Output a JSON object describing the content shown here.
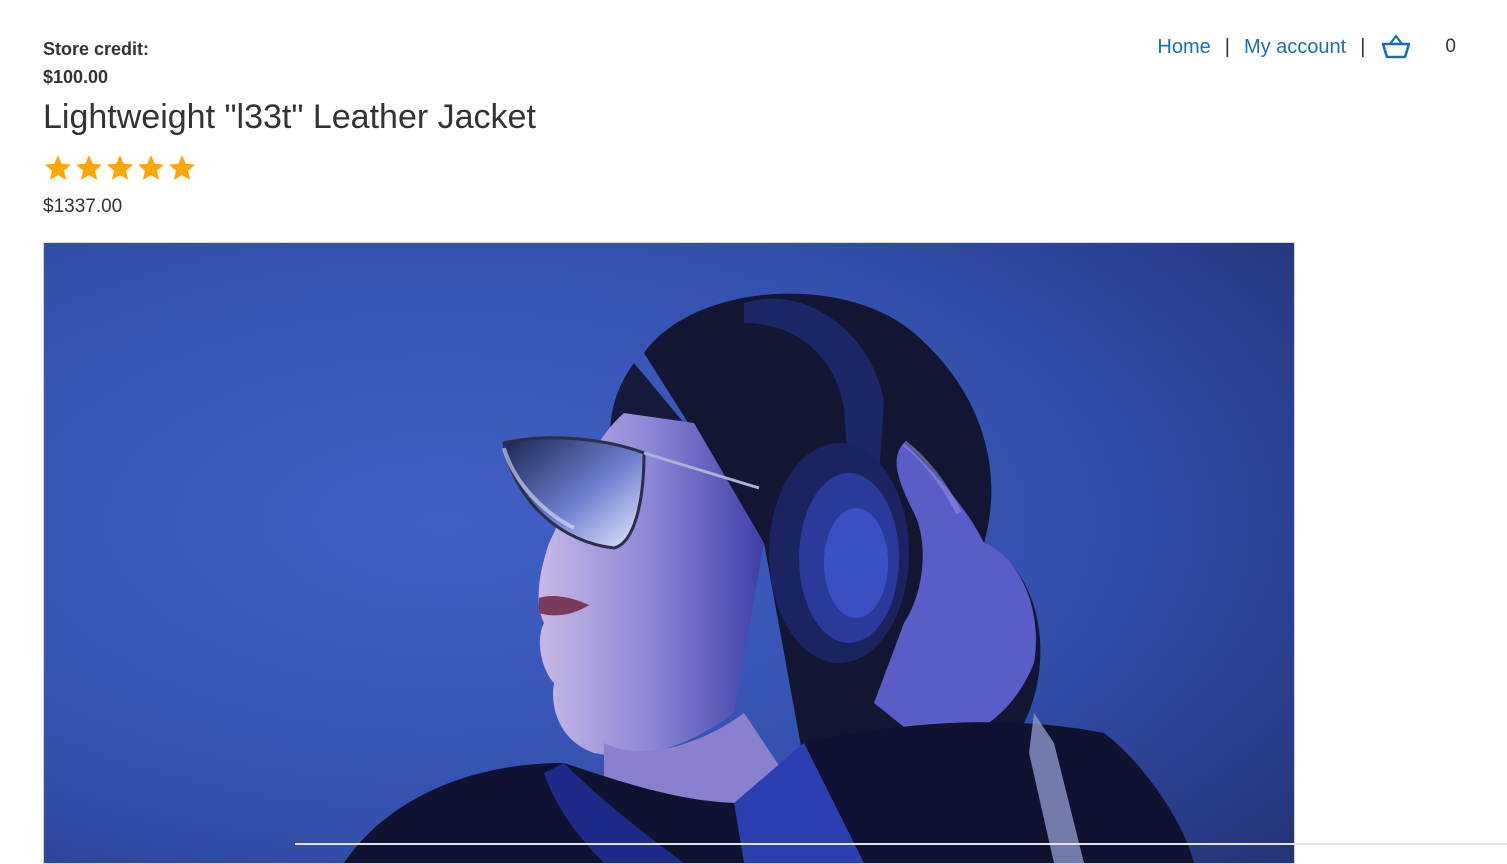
{
  "store_credit": {
    "label": "Store credit:",
    "amount": "$100.00"
  },
  "nav": {
    "home": "Home",
    "separator": "|",
    "account": "My account",
    "cart_icon": "basket-icon",
    "cart_count": "0"
  },
  "product": {
    "title": "Lightweight \"l33t\" Leather Jacket",
    "rating": 5,
    "rating_max": 5,
    "price": "$1337.00",
    "image_alt": "woman-with-headphones-photo"
  },
  "colors": {
    "link": "#1a6fb3",
    "text": "#333333",
    "star": "#ffa600",
    "photo_background": "#2f4faa"
  }
}
